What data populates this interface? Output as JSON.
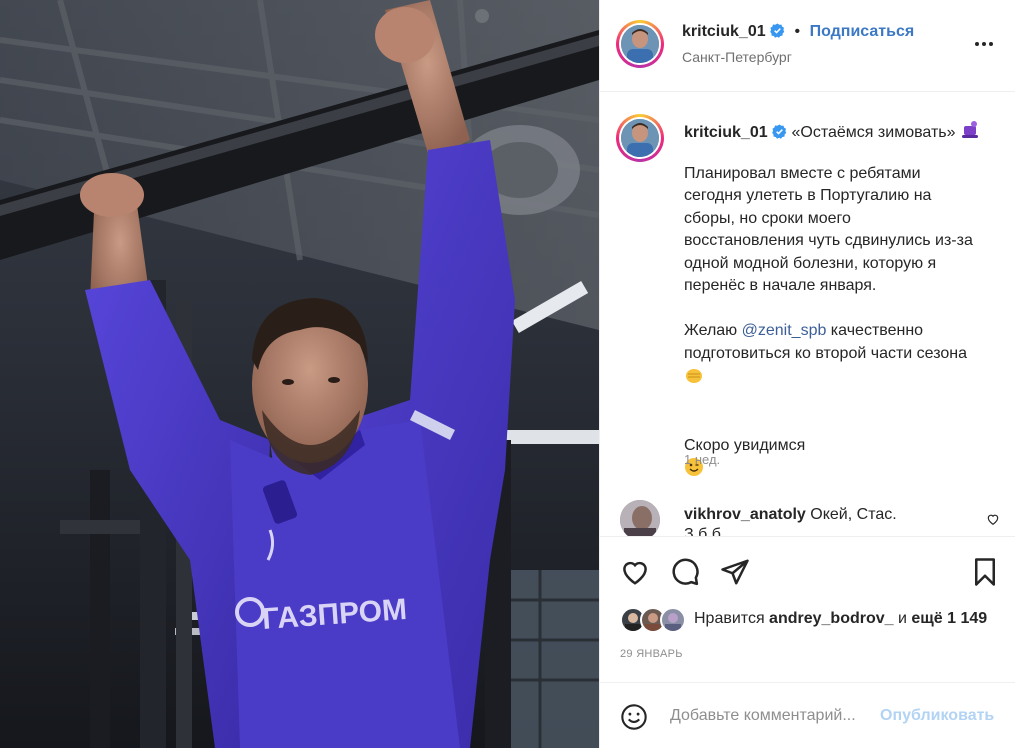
{
  "post_header": {
    "username": "kritciuk_01",
    "separator": "•",
    "follow_label": "Подписаться",
    "location": "Санкт-Петербург"
  },
  "caption": {
    "username": "kritciuk_01",
    "title": "«Остаёмся зимовать»",
    "paragraph1": "Планировал вместе с ребятами\nсегодня улететь в Португалию на\nсборы, но сроки моего\nвосстановления чуть сдвинулись из-за\nодной модной болезни, которую я\nперенёс в начале января.",
    "p2_before": "Желаю ",
    "p2_mention": "@zenit_spb",
    "p2_after": " качественно\nподготовиться ко второй части сезона",
    "paragraph3": "Скоро увидимся",
    "time_ago": "1 нед."
  },
  "comment": {
    "username": "vikhrov_anatoly",
    "text": "Окей, Стас.",
    "text_cut": "З                        б   б"
  },
  "likes": {
    "prefix": "Нравится ",
    "user": "andrey_bodrov_",
    "middle": " и ",
    "count": "ещё 1 149"
  },
  "post_date": "29 ЯНВАРЬ",
  "add_comment": {
    "placeholder": "Добавьте комментарий...",
    "publish_label": "Опубликовать"
  },
  "icons": {
    "verified": "verified-badge-icon",
    "more": "more-options-icon",
    "like": "heart-icon",
    "comment": "comment-icon",
    "share": "share-icon",
    "save": "bookmark-icon",
    "emoji": "smiley-icon"
  },
  "colors": {
    "accent": "#0095f6",
    "follow": "#3c78c4",
    "mention": "#3c5f98",
    "muted": "#8e8e8e",
    "jersey": "#4a39c9"
  }
}
